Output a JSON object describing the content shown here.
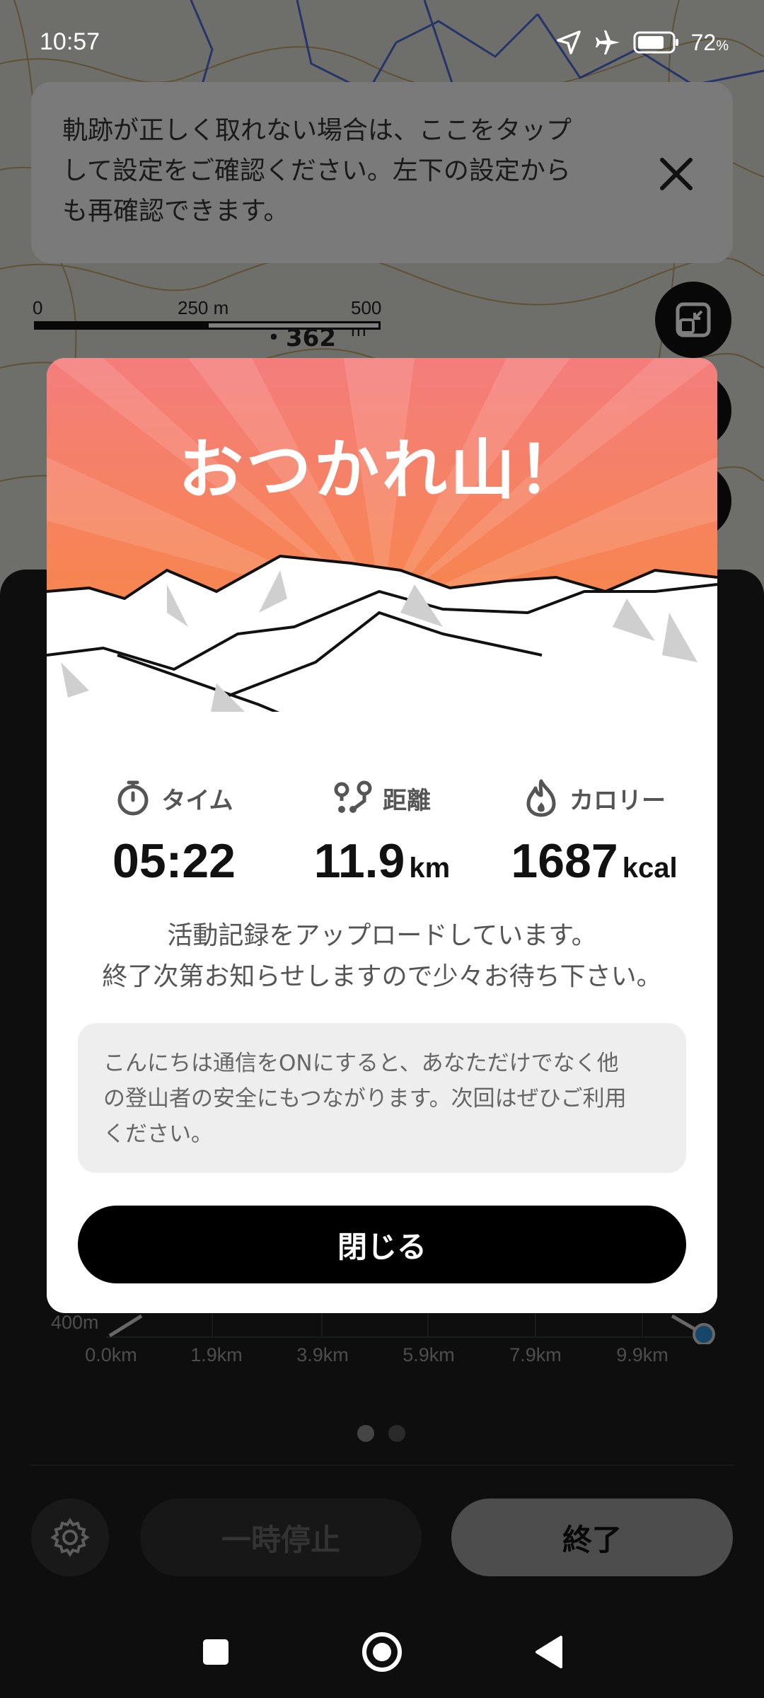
{
  "status_bar": {
    "time": "10:57",
    "battery_percent": "72",
    "battery_unit": "%"
  },
  "notice": {
    "text": "軌跡が正しく取れない場合は、ここをタップ\nして設定をご確認ください。左下の設定から\nも再確認できます。"
  },
  "map": {
    "scale_labels": [
      "0",
      "250 m",
      "500 m"
    ],
    "height_label": "・362"
  },
  "modal": {
    "title": "おつかれ山！",
    "stats": [
      {
        "label": "タイム",
        "value": "05:22",
        "unit": ""
      },
      {
        "label": "距離",
        "value": "11.9",
        "unit": "km"
      },
      {
        "label": "カロリー",
        "value": "1687",
        "unit": "kcal"
      }
    ],
    "upload_message": "活動記録をアップロードしています。\n終了次第お知らせしますので少々お待ち下さい。",
    "info_message": "こんにちは通信をONにすると、あなただけでなく他\nの登山者の安全にもつながります。次回はぜひご利用\nください。",
    "close_label": "閉じる"
  },
  "chart": {
    "y_label": "400m",
    "x_ticks": [
      "0.0km",
      "1.9km",
      "3.9km",
      "5.9km",
      "7.9km",
      "9.9km"
    ]
  },
  "pager": {
    "pages": 2,
    "current": 1
  },
  "controls": {
    "pause_label": "一時停止",
    "end_label": "終了"
  },
  "colors": {
    "header_top": "#f47d7d",
    "header_bottom": "#f78a3a",
    "button_dark": "#000000",
    "chart_point": "#2f8fd0"
  }
}
